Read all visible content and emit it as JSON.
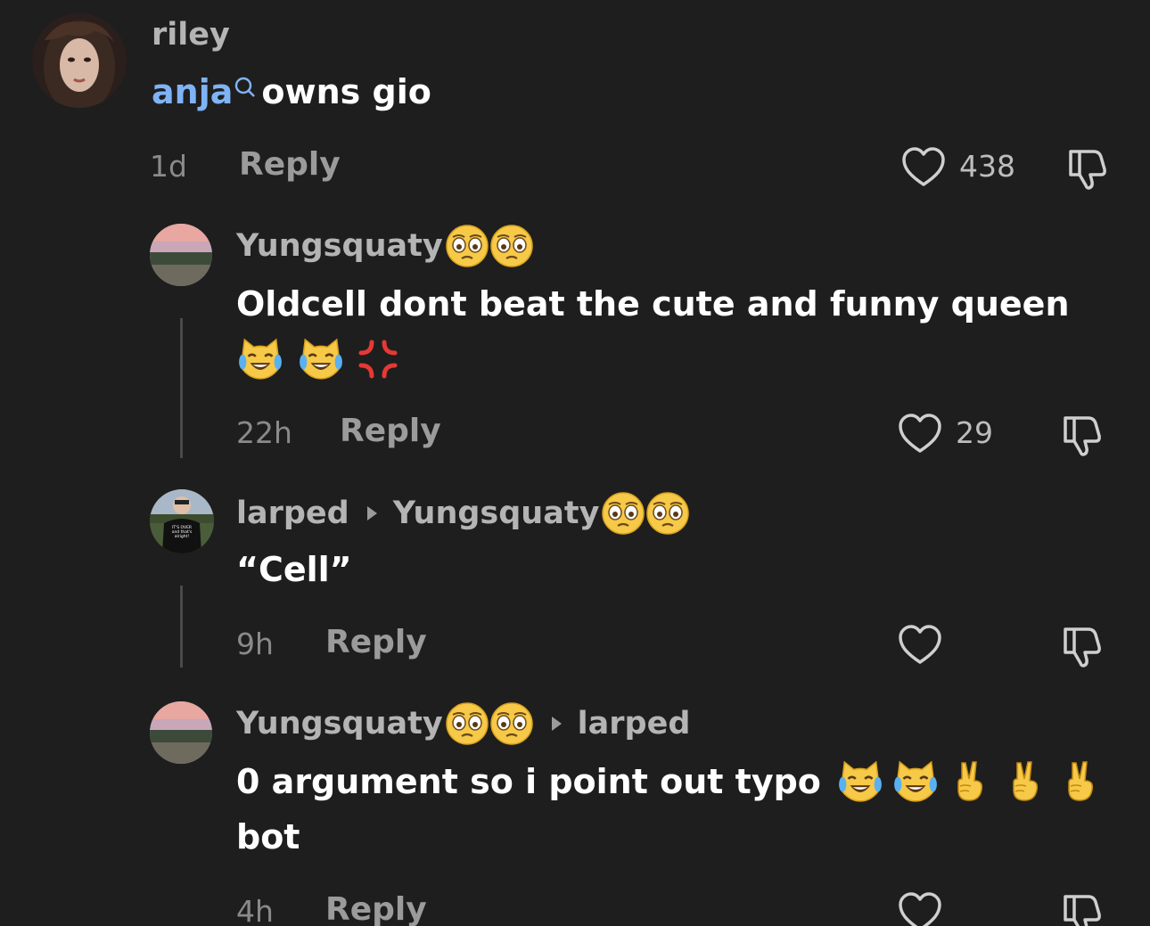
{
  "comments": [
    {
      "username": "riley",
      "mention": "anja",
      "text": "owns gio",
      "time": "1d",
      "reply_label": "Reply",
      "likes": "438"
    },
    {
      "username": "Yungsquaty",
      "username_emojis": [
        "pleading-face",
        "pleading-face"
      ],
      "text": "Oldcell dont beat the cute and funny queen",
      "text_emojis": [
        "cat-joy",
        "cat-joy",
        "anger-symbol"
      ],
      "time": "22h",
      "reply_label": "Reply",
      "likes": "29"
    },
    {
      "username": "larped",
      "reply_to": "Yungsquaty",
      "reply_to_emojis": [
        "pleading-face",
        "pleading-face"
      ],
      "text": "“Cell”",
      "time": "9h",
      "reply_label": "Reply",
      "likes": ""
    },
    {
      "username": "Yungsquaty",
      "username_emojis": [
        "pleading-face",
        "pleading-face"
      ],
      "reply_to": "larped",
      "text": "0 argument so i point out typo",
      "text_emojis": [
        "cat-joy",
        "cat-joy",
        "victory-hand",
        "victory-hand",
        "victory-hand"
      ],
      "text_line2": "bot",
      "time": "4h",
      "reply_label": "Reply",
      "likes": ""
    }
  ],
  "colors": {
    "background": "#1e1e1e",
    "mention": "#7fb3f5",
    "username": "#b4b4b4",
    "meta": "#8a8a8a"
  }
}
